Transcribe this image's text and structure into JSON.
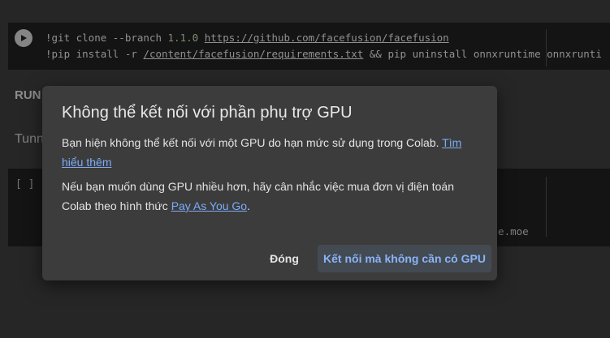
{
  "notebook": {
    "cell1": {
      "line1": {
        "cmd": "!git clone --branch ",
        "version": "1.1.0",
        "space": " ",
        "url": "https://github.com/facefusion/facefusion"
      },
      "line2": {
        "cmd": "!pip install -r ",
        "path": "/content/facefusion/requirements.txt",
        "rest": " && pip uninstall onnxruntime onnxrunti"
      }
    },
    "run_heading": "RUN",
    "tunnel_text": "Tunn",
    "cell2": {
      "bracket": "[ ]",
      "output_fragment": "ote.moe"
    }
  },
  "dialog": {
    "title": "Không thể kết nối với phần phụ trợ GPU",
    "p1_text": "Bạn hiện không thể kết nối với một GPU do hạn mức sử dụng trong Colab. ",
    "p1_link": "Tìm hiểu thêm",
    "p2_text": "Nếu bạn muốn dùng GPU nhiều hơn, hãy cân nhắc việc mua đơn vị điện toán Colab theo hình thức ",
    "p2_link": "Pay As You Go",
    "p2_end": ".",
    "close_label": "Đóng",
    "connect_label": "Kết nối mà không cần có GPU"
  },
  "colors": {
    "background": "#383838",
    "cell": "#1e1e1e",
    "dialog": "#3c3c3c",
    "link": "#7cacf8",
    "primary_button_text": "#8ab4f8"
  },
  "icons": {
    "run": "play-icon"
  }
}
